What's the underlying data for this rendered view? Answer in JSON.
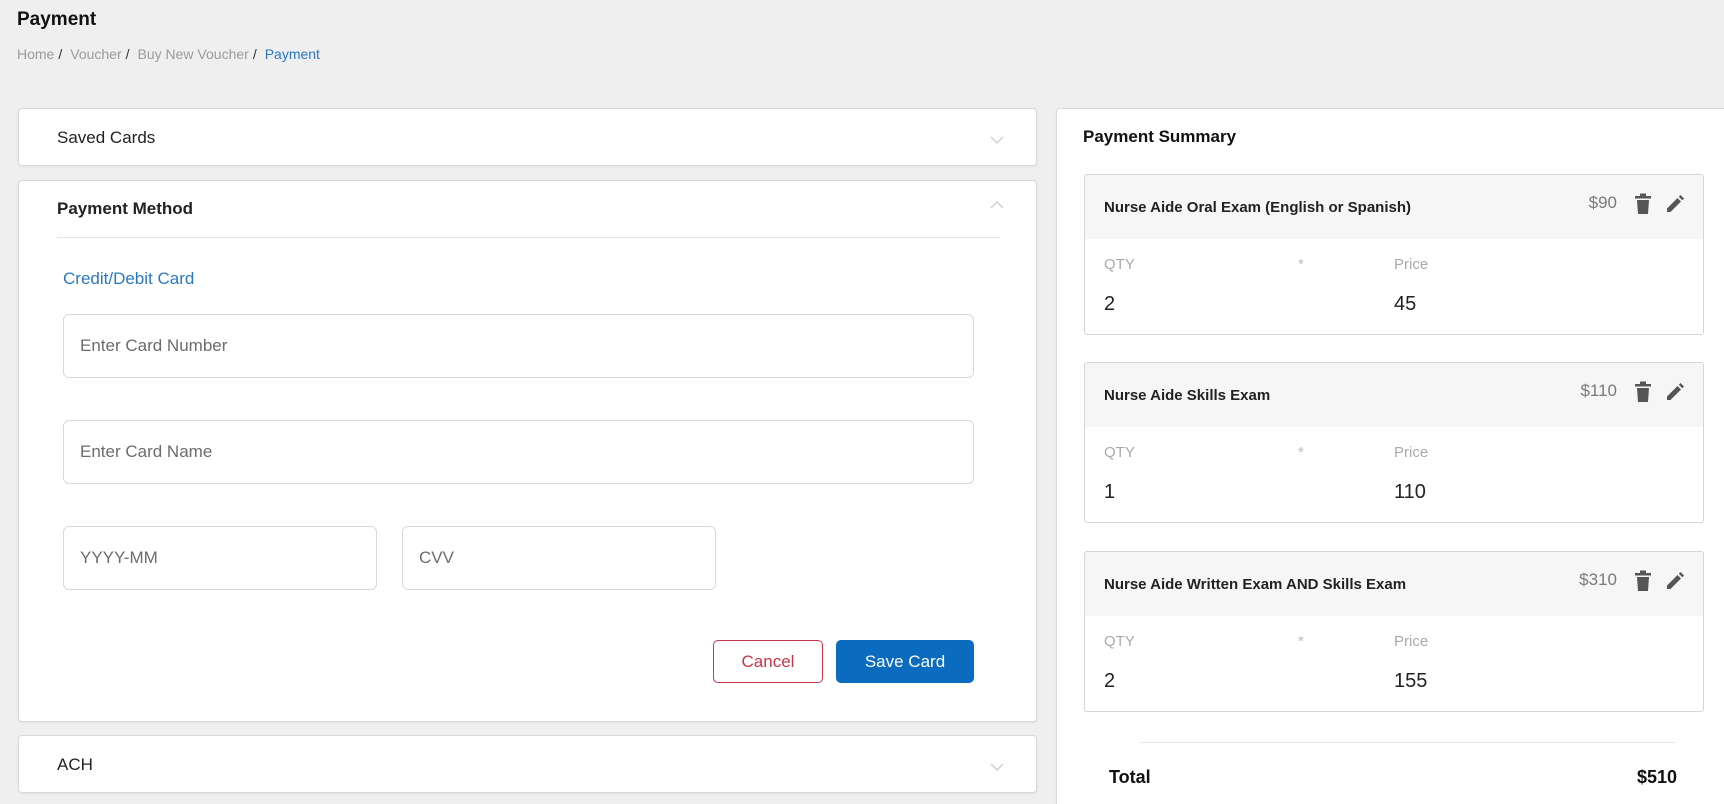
{
  "header": {
    "title": "Payment",
    "breadcrumb": [
      "Home",
      "Voucher",
      "Buy New Voucher",
      "Payment"
    ],
    "breadcrumb_separator": "/"
  },
  "sections": {
    "saved_cards": {
      "label": "Saved Cards",
      "icon": "chevron-down-icon"
    },
    "payment_method": {
      "label": "Payment Method",
      "icon": "chevron-up-icon",
      "method_link": "Credit/Debit Card",
      "fields": {
        "card_number": {
          "value": "",
          "placeholder": "Enter Card Number"
        },
        "card_name": {
          "value": "",
          "placeholder": "Enter Card Name"
        },
        "expiry": {
          "value": "",
          "placeholder": "YYYY-MM"
        },
        "cvv": {
          "value": "",
          "placeholder": "CVV"
        }
      },
      "cancel_label": "Cancel",
      "save_label": "Save Card"
    },
    "ach": {
      "label": "ACH",
      "icon": "chevron-down-icon"
    }
  },
  "summary": {
    "title": "Payment Summary",
    "column_labels": {
      "qty": "QTY",
      "times": "*",
      "price": "Price"
    },
    "items": [
      {
        "name": "Nurse Aide Oral Exam (English or Spanish)",
        "amount": "$90",
        "qty": "2",
        "price": "45"
      },
      {
        "name": "Nurse Aide Skills Exam",
        "amount": "$110",
        "qty": "1",
        "price": "110"
      },
      {
        "name": "Nurse Aide Written Exam AND Skills Exam",
        "amount": "$310",
        "qty": "2",
        "price": "155"
      }
    ],
    "total_label": "Total",
    "total_value": "$510"
  },
  "colors": {
    "accent": "#2a78c2",
    "primary_button": "#0b6bbf",
    "danger": "#c8354a",
    "background": "#efefef"
  }
}
